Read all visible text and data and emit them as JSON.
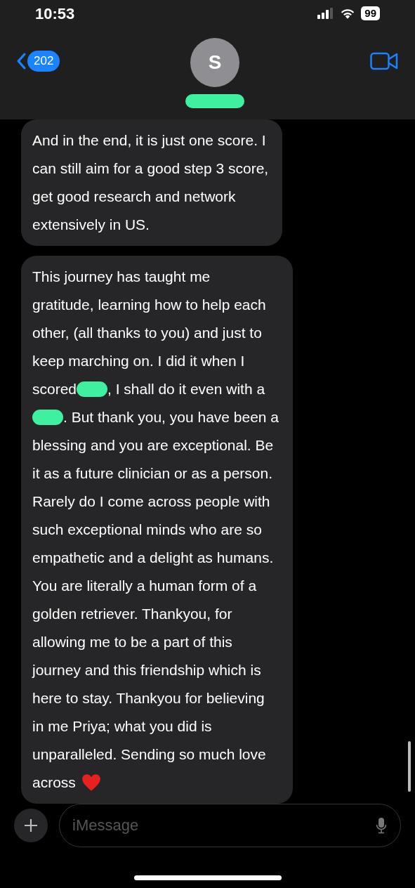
{
  "status_bar": {
    "time": "10:53",
    "battery": "99"
  },
  "header": {
    "back_count": "202",
    "avatar_initial": "S",
    "name_redacted": true
  },
  "messages": [
    {
      "lines": [
        {
          "segments": [
            {
              "kind": "text",
              "text": "And in the end, it is just one score. I"
            }
          ]
        },
        {
          "segments": [
            {
              "kind": "text",
              "text": "can still aim for a good step 3 score,"
            }
          ]
        },
        {
          "segments": [
            {
              "kind": "text",
              "text": "get good research and network"
            }
          ]
        },
        {
          "segments": [
            {
              "kind": "text",
              "text": "extensively in US."
            }
          ]
        }
      ]
    },
    {
      "lines": [
        {
          "segments": [
            {
              "kind": "text",
              "text": "This journey has taught me"
            }
          ]
        },
        {
          "segments": [
            {
              "kind": "text",
              "text": "gratitude, learning how to help each"
            }
          ]
        },
        {
          "segments": [
            {
              "kind": "text",
              "text": "other, (all thanks to you) and just to"
            }
          ]
        },
        {
          "segments": [
            {
              "kind": "text",
              "text": "keep marching on. I did it when I"
            }
          ]
        },
        {
          "segments": [
            {
              "kind": "text",
              "text": "scored"
            },
            {
              "kind": "redaction"
            },
            {
              "kind": "text",
              "text": ", I shall do it even with a"
            }
          ]
        },
        {
          "segments": [
            {
              "kind": "redaction"
            },
            {
              "kind": "text",
              "text": ". But thank you, you have been a"
            }
          ]
        },
        {
          "segments": [
            {
              "kind": "text",
              "text": "blessing and you are exceptional. Be"
            }
          ]
        },
        {
          "segments": [
            {
              "kind": "text",
              "text": "it as a future clinician or as a person."
            }
          ]
        },
        {
          "segments": [
            {
              "kind": "text",
              "text": "Rarely do I come across people with"
            }
          ]
        },
        {
          "segments": [
            {
              "kind": "text",
              "text": "such exceptional minds who are so"
            }
          ]
        },
        {
          "segments": [
            {
              "kind": "text",
              "text": "empathetic and a delight as humans."
            }
          ]
        },
        {
          "segments": [
            {
              "kind": "text",
              "text": "You are literally a human form of a"
            }
          ]
        },
        {
          "segments": [
            {
              "kind": "text",
              "text": "golden retriever. Thankyou, for"
            }
          ]
        },
        {
          "segments": [
            {
              "kind": "text",
              "text": "allowing me to be a part of this"
            }
          ]
        },
        {
          "segments": [
            {
              "kind": "text",
              "text": "journey and this friendship which is"
            }
          ]
        },
        {
          "segments": [
            {
              "kind": "text",
              "text": "here to stay. Thankyou for believing"
            }
          ]
        },
        {
          "segments": [
            {
              "kind": "text",
              "text": "in me Priya; what you did is"
            }
          ]
        },
        {
          "segments": [
            {
              "kind": "text",
              "text": "unparalleled. Sending so much love"
            }
          ]
        },
        {
          "segments": [
            {
              "kind": "text",
              "text": "across"
            },
            {
              "kind": "heart"
            }
          ]
        }
      ]
    }
  ],
  "composer": {
    "placeholder": "iMessage"
  }
}
